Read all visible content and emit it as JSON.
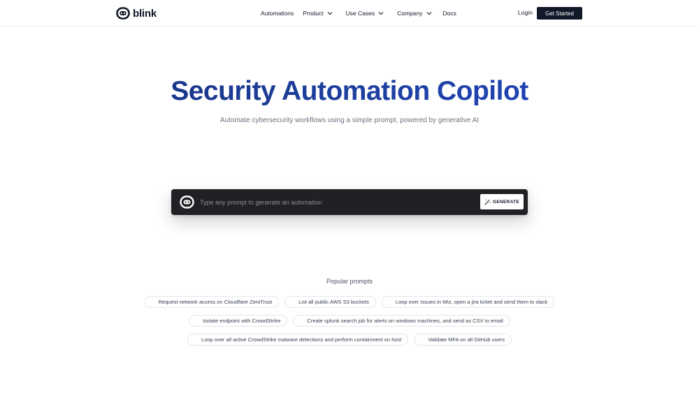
{
  "nav": {
    "brand": "blink",
    "links": [
      {
        "label": "Automations",
        "has_dropdown": false
      },
      {
        "label": "Product",
        "has_dropdown": true
      },
      {
        "label": "Use Cases",
        "has_dropdown": true
      },
      {
        "label": "Company",
        "has_dropdown": true
      },
      {
        "label": "Docs",
        "has_dropdown": false
      }
    ],
    "login": "Login",
    "cta": "Get Started"
  },
  "hero": {
    "title": "Security Automation Copilot",
    "subtitle": "Automate cybersecurity workflows using a simple prompt, powered by generative AI"
  },
  "prompt": {
    "placeholder": "Type any prompt to generate an automation",
    "value": "",
    "button_label": "GENERATE",
    "button_icon": "magic-wand-icon"
  },
  "popular": {
    "title": "Popular prompts",
    "rows": [
      [
        "Request network access on Cloudflare ZeroTrust",
        "List all public AWS S3 buckets",
        "Loop over Issues in Wiz, open a jira ticket and send them to slack"
      ],
      [
        "Isolate endpoint with CrowdStrike",
        "Create splunk search job for alerts on windows machines, and send as CSV to email"
      ],
      [
        "Loop over all active CrowdStrike malware detections and perform containment on host",
        "Validate MFA on all GitHub users"
      ]
    ]
  },
  "colors": {
    "primary_dark": "#111827",
    "prompt_bg": "#202124",
    "title_gradient_start": "#16307a",
    "title_gradient_end": "#2447c4"
  }
}
